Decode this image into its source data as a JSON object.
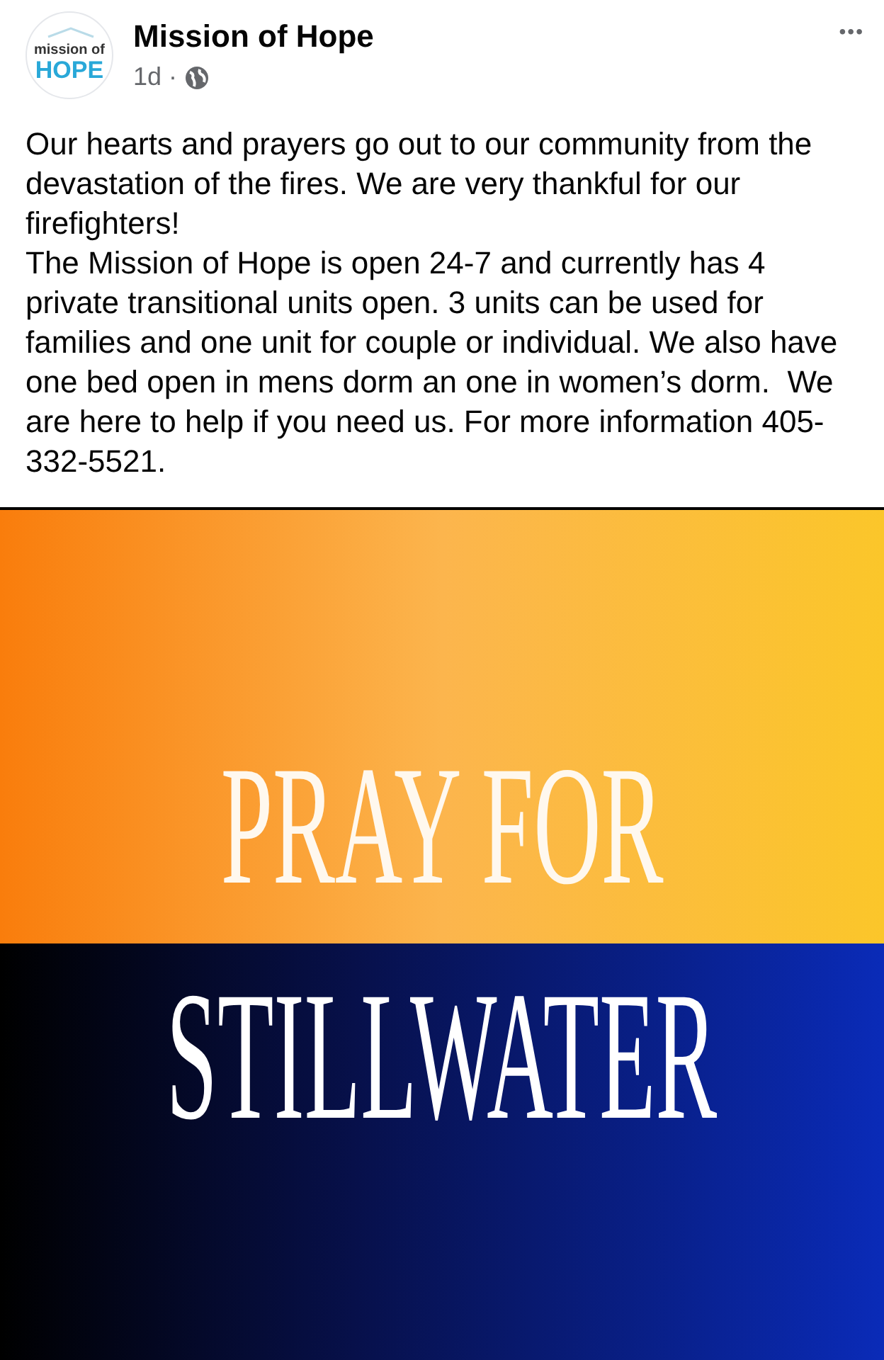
{
  "post": {
    "author": "Mission of Hope",
    "avatar_text": [
      "mission of",
      "HOPE"
    ],
    "time": "1d",
    "separator": "·",
    "menu": "•••",
    "paragraphs": [
      "Our hearts and prayers go out to our community from the devastation of the fires. We are very thankful for our firefighters!",
      "The Mission of Hope is open 24-7 and currently has 4 private transitional units open. 3 units can be used for families and one unit for couple or individual. We also have one bed open in mens dorm an one in women’s dorm.  We are here to help if you need us. For more information 405-332-5521."
    ],
    "image_text": [
      "PRAY FOR",
      "STILLWATER"
    ]
  }
}
